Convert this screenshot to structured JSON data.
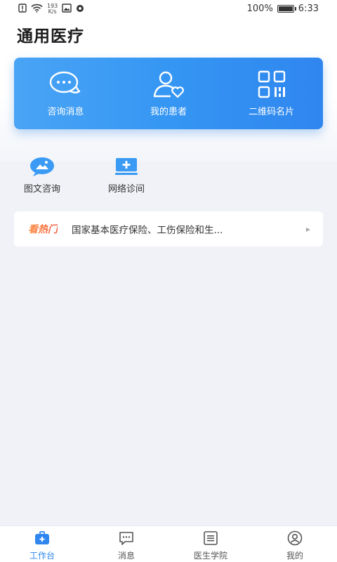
{
  "status_bar": {
    "net_speed_value": "193",
    "net_speed_unit": "K/s",
    "battery": "100%",
    "time": "6:33"
  },
  "header": {
    "title": "通用医疗"
  },
  "main_card": {
    "items": [
      {
        "label": "咨询消息",
        "icon": "chat-bubble-icon"
      },
      {
        "label": "我的患者",
        "icon": "patient-icon"
      },
      {
        "label": "二维码名片",
        "icon": "qr-code-icon"
      }
    ]
  },
  "features": [
    {
      "label": "图文咨询",
      "icon": "image-chat-icon"
    },
    {
      "label": "网络诊间",
      "icon": "monitor-plus-icon"
    }
  ],
  "hot": {
    "tag": "看热门",
    "text": "国家基本医疗保险、工伤保险和生..."
  },
  "tabs": [
    {
      "label": "工作台",
      "icon": "briefcase-icon",
      "active": true
    },
    {
      "label": "消息",
      "icon": "message-icon",
      "active": false
    },
    {
      "label": "医生学院",
      "icon": "list-icon",
      "active": false
    },
    {
      "label": "我的",
      "icon": "user-icon",
      "active": false
    }
  ],
  "colors": {
    "accent": "#2f86ef",
    "card_gradient_start": "#49a4f5",
    "hot_tag": "#f25a3c"
  }
}
